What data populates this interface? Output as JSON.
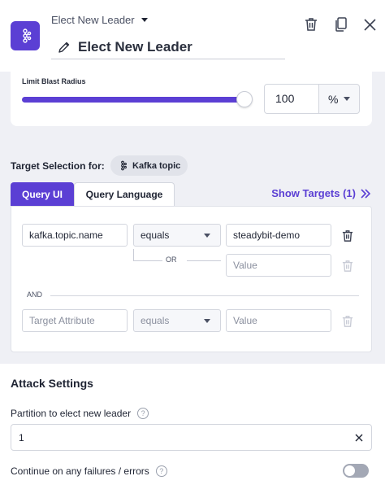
{
  "header": {
    "type_select_label": "Elect New Leader",
    "title": "Elect New Leader"
  },
  "blast_radius": {
    "label": "Limit Blast Radius",
    "value": "100",
    "unit": "%",
    "slider_level_percent": 100
  },
  "target_selection": {
    "label": "Target Selection for:",
    "target_type": "Kafka topic",
    "tabs": [
      {
        "label": "Query UI",
        "active": true
      },
      {
        "label": "Query Language",
        "active": false
      }
    ],
    "show_targets": "Show Targets (1)",
    "rows": [
      {
        "attribute": "kafka.topic.name",
        "operator": "equals",
        "value": "steadybit-demo"
      },
      {
        "attribute": "",
        "operator": "",
        "value": "",
        "value_placeholder": "Value"
      },
      {
        "attribute": "",
        "attribute_placeholder": "Target Attribute",
        "operator": "equals",
        "value": "",
        "value_placeholder": "Value"
      }
    ],
    "or_label": "OR",
    "and_label": "AND"
  },
  "attack_settings": {
    "title": "Attack Settings",
    "partition_label": "Partition to elect new leader",
    "partition_value": "1",
    "continue_label": "Continue on any failures / errors",
    "continue_enabled": false
  },
  "colors": {
    "accent": "#5b3fd4",
    "panel_gray": "#eff0f5"
  },
  "icons": {
    "app": "kafka-icon",
    "title_edit": "pencil-icon",
    "delete": "trash-icon",
    "duplicate": "copy-icon",
    "close": "close-icon",
    "show_targets": "double-chevron-right-icon",
    "help": "question-circle-icon"
  }
}
